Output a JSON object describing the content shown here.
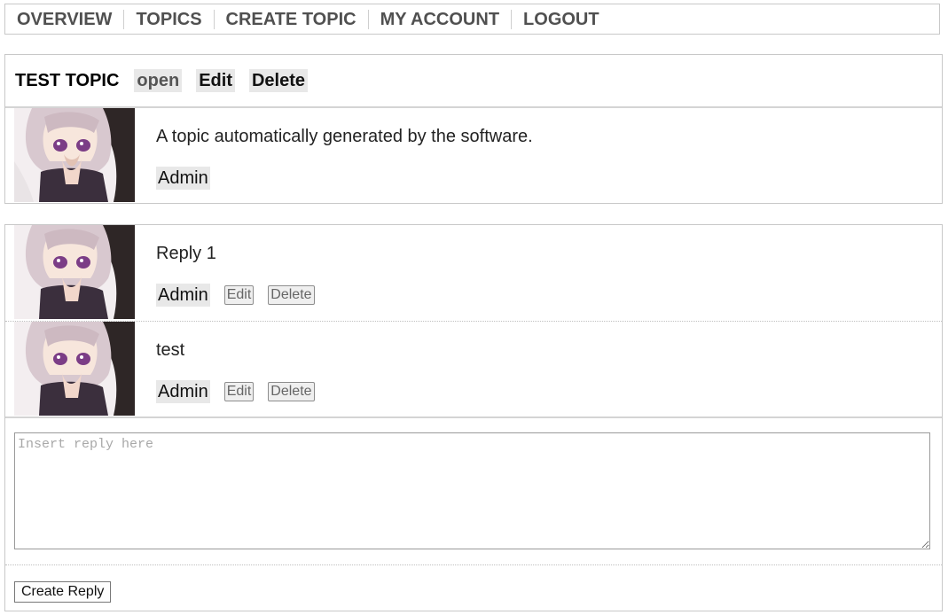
{
  "nav": {
    "items": [
      "OVERVIEW",
      "TOPICS",
      "CREATE TOPIC",
      "MY ACCOUNT",
      "LOGOUT"
    ]
  },
  "topic": {
    "title": "TEST TOPIC",
    "status": "open",
    "edit_label": "Edit",
    "delete_label": "Delete",
    "body": "A topic automatically generated by the software.",
    "author": "Admin"
  },
  "replies": [
    {
      "text": "Reply 1",
      "author": "Admin",
      "edit_label": "Edit",
      "delete_label": "Delete"
    },
    {
      "text": "test",
      "author": "Admin",
      "edit_label": "Edit",
      "delete_label": "Delete"
    }
  ],
  "reply_form": {
    "placeholder": "Insert reply here",
    "value": "",
    "submit_label": "Create Reply"
  },
  "colors": {
    "border": "#c8c8c8",
    "chip_background": "#e8e8e8",
    "nav_text": "#505050"
  },
  "icons": {
    "avatar": "user-avatar-image"
  }
}
